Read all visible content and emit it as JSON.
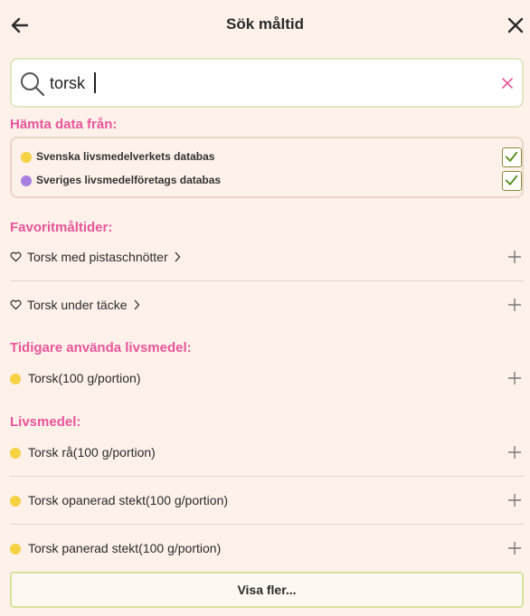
{
  "header": {
    "title": "Sök måltid"
  },
  "search": {
    "value": "torsk",
    "placeholder": ""
  },
  "sources": {
    "heading": "Hämta data från:",
    "items": [
      {
        "label": "Svenska livsmedelverkets databas",
        "dot_color": "#f5d243",
        "checked": true
      },
      {
        "label": "Sveriges livsmedelföretags databas",
        "dot_color": "#a87ee0",
        "checked": true
      }
    ]
  },
  "favorites": {
    "heading": "Favoritmåltider:",
    "items": [
      {
        "label": "Torsk med pistaschnötter"
      },
      {
        "label": "Torsk under täcke"
      }
    ]
  },
  "recent": {
    "heading": "Tidigare använda livsmedel:",
    "items": [
      {
        "label": "Torsk(100 g/portion)"
      }
    ]
  },
  "foods": {
    "heading": "Livsmedel:",
    "items": [
      {
        "label": "Torsk rå(100 g/portion)"
      },
      {
        "label": "Torsk opanerad stekt(100 g/portion)"
      },
      {
        "label": "Torsk panerad stekt(100 g/portion)"
      }
    ]
  },
  "more_button": {
    "label": "Visa fler..."
  },
  "colors": {
    "accent_pink": "#e8559a",
    "background": "#fdf1ea",
    "check_green": "#5a8f1f"
  },
  "icons": {
    "back": "arrow-left-icon",
    "close": "close-icon",
    "search": "magnifier-icon",
    "clear": "clear-x-icon",
    "favorite": "heart-icon",
    "add": "plus-icon",
    "chevron": "chevron-right-icon"
  }
}
